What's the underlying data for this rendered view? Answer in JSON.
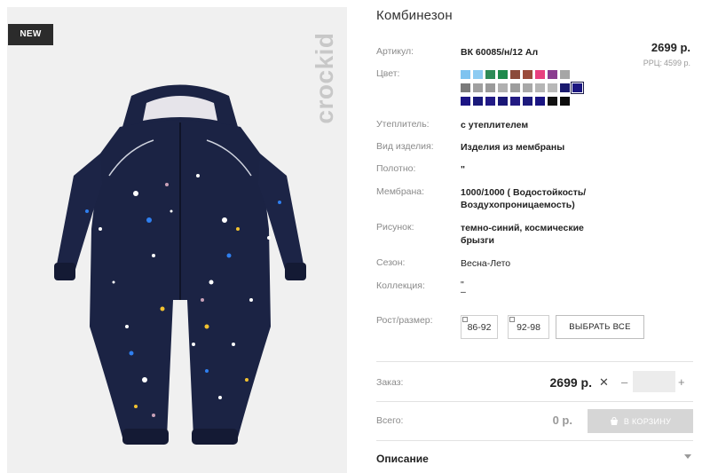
{
  "product_image": {
    "badge": "NEW",
    "brand_logo": "crockid"
  },
  "product": {
    "title": "Комбинезон",
    "price": "2699 р.",
    "rrp_label": "РРЦ:",
    "rrp_value": "4599 р."
  },
  "specs": [
    {
      "label": "Артикул:",
      "value": "ВК 60085/н/12 Ал"
    },
    {
      "label": "Цвет:",
      "value": ""
    },
    {
      "label": "Утеплитель:",
      "value": "с утеплителем"
    },
    {
      "label": "Вид изделия:",
      "value": "Изделия из мембраны"
    },
    {
      "label": "Полотно:",
      "value": "\""
    },
    {
      "label": "Мембрана:",
      "value": "1000/1000 ( Водостойкость/",
      "value2": "Воздухопроницаемость)"
    },
    {
      "label": "Рисунок:",
      "value": "темно-синий, космические",
      "value2": "брызги"
    },
    {
      "label": "Сезон:",
      "value": "Весна-Лето"
    },
    {
      "label": "Коллекция:",
      "value": "\"",
      "value2": "–"
    }
  ],
  "colors": {
    "row1": [
      "#7ec3f0",
      "#8ccbf2",
      "#2e8b57",
      "#1f8a4c",
      "#8b4a3a",
      "#9a4b3b",
      "#e8407f",
      "#8a3d8f",
      "#a6a6a6"
    ],
    "row2": [
      "#7a7a7a",
      "#a0a0a0",
      "#9a9a9a",
      "#b0b0b0",
      "#9d9d9d",
      "#a8a8a8",
      "#b5b5b5",
      "#b8b8b8",
      "#1a1a6e",
      "#1b1680"
    ],
    "row3": [
      "#1c1584",
      "#1a1a7a",
      "#221a86",
      "#1a1877",
      "#221a82",
      "#1d1a7c",
      "#1a1582",
      "#111111",
      "#0d0d0d"
    ],
    "selected_index": 18
  },
  "size": {
    "label": "Рост/размер:",
    "options": [
      "86-92",
      "92-98"
    ],
    "select_all": "ВЫБРАТЬ ВСЕ"
  },
  "order": {
    "label": "Заказ:",
    "price": "2699 р.",
    "close_glyph": "✕",
    "minus": "–",
    "plus": "+",
    "quantity": ""
  },
  "total": {
    "label": "Всего:",
    "value": "0 р.",
    "cart_button": "В КОРЗИНУ",
    "cart_icon": "cart-icon"
  },
  "description": {
    "title": "Описание",
    "toggle_icon": "chevron-down-icon"
  }
}
